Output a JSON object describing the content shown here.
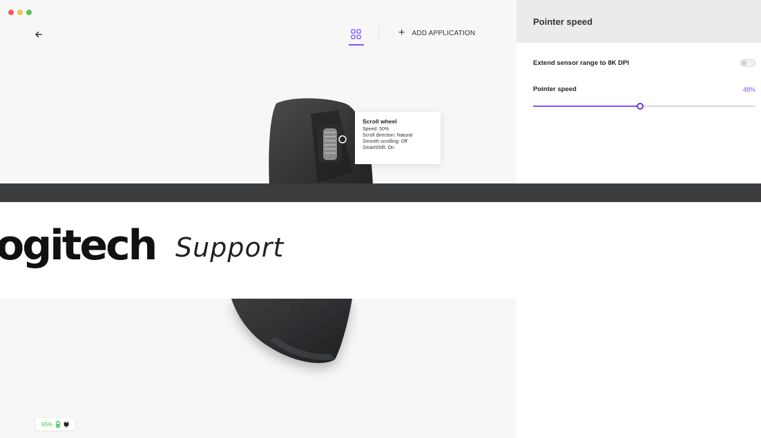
{
  "app": {
    "back_label": "←",
    "add_application_label": "ADD APPLICATION"
  },
  "tooltip": {
    "title": "Scroll wheel",
    "lines": [
      "Speed: 50%",
      "Scroll direction: Natural",
      "Smooth scrolling: Off",
      "SmartShift: On"
    ]
  },
  "panel": {
    "title": "Pointer speed",
    "extend_label": "Extend sensor range to 8K DPI",
    "extend_enabled": false,
    "speed_label": "Pointer speed",
    "speed_value": "48%",
    "speed_fraction": 0.48
  },
  "banner": {
    "logo_text": "ogitech",
    "support_text": "Support"
  },
  "status": {
    "battery_text": "65%"
  },
  "colors": {
    "accent": "#814eff",
    "battery_green": "#3fbf4a"
  },
  "icons": {
    "back": "arrow-left-icon",
    "apps": "apps-grid-icon",
    "add": "plus-icon",
    "battery": "battery-icon",
    "plug": "plug-icon"
  }
}
